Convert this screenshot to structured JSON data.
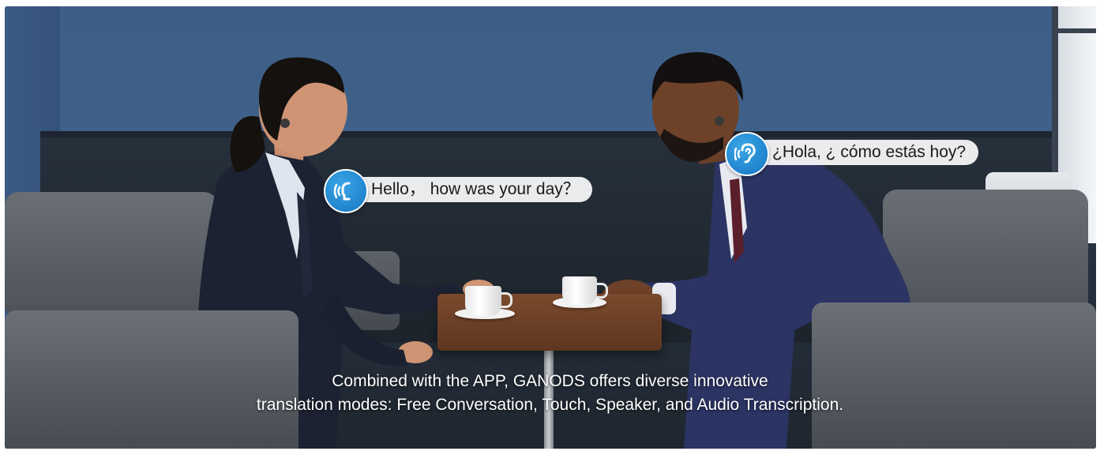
{
  "scene": {
    "description_icons": [
      "speaking-icon",
      "listening-icon"
    ]
  },
  "bubbles": {
    "left": {
      "text": "Hello， how was your day？",
      "icon": "speaking-icon"
    },
    "right": {
      "text": "¿Hola, ¿ cómo estás hoy?",
      "icon": "listening-icon"
    }
  },
  "caption": {
    "line1": "Combined with the APP, GANODS offers diverse innovative",
    "line2": "translation modes: Free Conversation, Touch,  Speaker, and Audio Transcription."
  },
  "colors": {
    "accent_blue": "#1e88d8",
    "bubble_bg": "#f5f5f5"
  }
}
